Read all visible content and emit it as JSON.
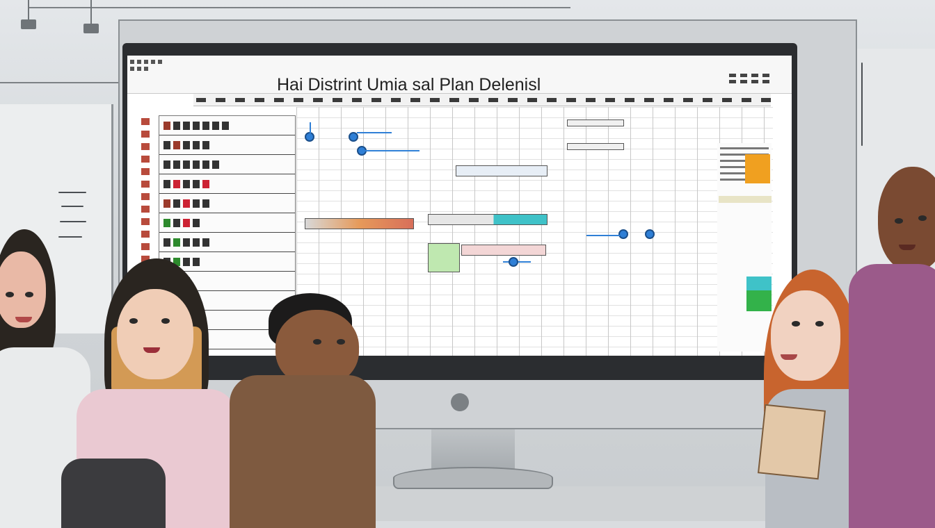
{
  "window": {
    "title": "Hai Distrint Umia sal Plan Delenisl"
  },
  "colors": {
    "screen_bg": "#ffffff",
    "accent_blue": "#2f7fd6",
    "accent_orange": "#f0a020",
    "accent_green": "#33b24a",
    "accent_teal": "#3fc2c8"
  },
  "icons": [
    "grid-icon",
    "toolbar-icon",
    "window-controls-icon",
    "node-icon"
  ]
}
